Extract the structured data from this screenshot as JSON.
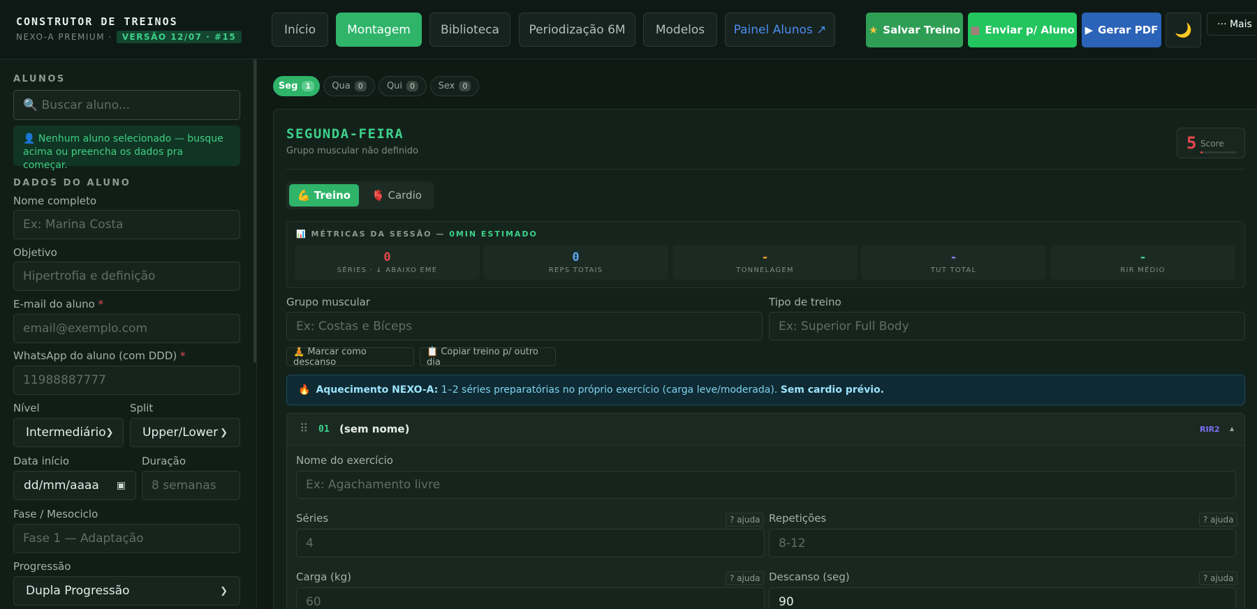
{
  "header": {
    "brand_title": "CONSTRUTOR DE TREINOS",
    "brand_sub": "NEXO-A PREMIUM ·",
    "version": "VERSÃO 12/07 · #15",
    "tabs": [
      {
        "label": "Início"
      },
      {
        "label": "Montagem"
      },
      {
        "label": "Biblioteca"
      },
      {
        "label": "Periodização 6M"
      },
      {
        "label": "Modelos"
      },
      {
        "label": "Painel Alunos ↗"
      }
    ],
    "actions": {
      "save": "Salvar Treino",
      "send": "Enviar p/ Aluno",
      "pdf": "Gerar PDF",
      "theme_icon": "🌙",
      "more": "··· Mais"
    }
  },
  "sidebar": {
    "students_label": "ALUNOS",
    "search_placeholder": "🔍 Buscar aluno...",
    "info_text": "👤 Nenhum aluno selecionado — busque acima ou preencha os dados pra começar.",
    "data_label": "DADOS DO ALUNO",
    "fields": {
      "name_label": "Nome completo",
      "name_placeholder": "Ex: Marina Costa",
      "goal_label": "Objetivo",
      "goal_placeholder": "Hipertrofia e definição",
      "email_label": "E-mail do aluno",
      "email_placeholder": "email@exemplo.com",
      "whatsapp_label": "WhatsApp do aluno (com DDD)",
      "whatsapp_placeholder": "11988887777",
      "required_mark": "*",
      "level_label": "Nível",
      "level_value": "Intermediário",
      "split_label": "Split",
      "split_value": "Upper/Lower",
      "start_label": "Data início",
      "start_value": "dd/mm/aaaa",
      "duration_label": "Duração",
      "duration_placeholder": "8 semanas",
      "phase_label": "Fase / Mesociclo",
      "phase_placeholder": "Fase 1 — Adaptação",
      "progression_label": "Progressão",
      "progression_value": "Dupla Progressão"
    }
  },
  "days": [
    {
      "label": "Seg",
      "count": "1"
    },
    {
      "label": "Qua",
      "count": "0"
    },
    {
      "label": "Qui",
      "count": "0"
    },
    {
      "label": "Sex",
      "count": "0"
    }
  ],
  "day_card": {
    "title": "SEGUNDA-FEIRA",
    "subtitle": "Grupo muscular não definido",
    "score_value": "5",
    "score_label": "Score",
    "score_fill": 0.05,
    "modes": {
      "treino": "💪 Treino",
      "cardio": "🫀 Cardio"
    },
    "metrics_title": "📊 MÉTRICAS DA SESSÃO — ",
    "metrics_highlight": "0MIN ESTIMADO",
    "metrics": [
      {
        "value": "0",
        "label": "SÉRIES · ↓ ABAIXO EME",
        "color": "#e5484d"
      },
      {
        "value": "0",
        "label": "REPS TOTAIS",
        "color": "#5aa9f0"
      },
      {
        "value": "-",
        "label": "TONNELAGEM",
        "color": "#f0a030"
      },
      {
        "value": "-",
        "label": "TUT TOTAL",
        "color": "#7b7ff0"
      },
      {
        "value": "-",
        "label": "RIR MÉDIO",
        "color": "#3ed18a"
      }
    ],
    "group_label": "Grupo muscular",
    "group_placeholder": "Ex: Costas e Bíceps",
    "type_label": "Tipo de treino",
    "type_placeholder": "Ex: Superior Full Body",
    "rest_btn": "🧘 Marcar como descanso",
    "copy_btn": "📋 Copiar treino p/ outro dia",
    "warmup_bold": "Aquecimento NEXO-A:",
    "warmup_text": "1–2 séries preparatórias no próprio exercício (carga leve/moderada).",
    "warmup_bold2": "Sem cardio prévio.",
    "warmup_icon": "🔥"
  },
  "exercise": {
    "drag_icon": "⠿",
    "number": "01",
    "name": "(sem nome)",
    "rir_badge": "RIR2",
    "collapse_icon": "▲",
    "name_label": "Nome do exercício",
    "name_placeholder": "Ex: Agachamento livre",
    "sets_label": "Séries",
    "sets_placeholder": "4",
    "reps_label": "Repetições",
    "reps_placeholder": "8-12",
    "load_label": "Carga (kg)",
    "load_placeholder": "60",
    "rest_label": "Descanso (seg)",
    "rest_value": "90",
    "help": "? ajuda"
  }
}
